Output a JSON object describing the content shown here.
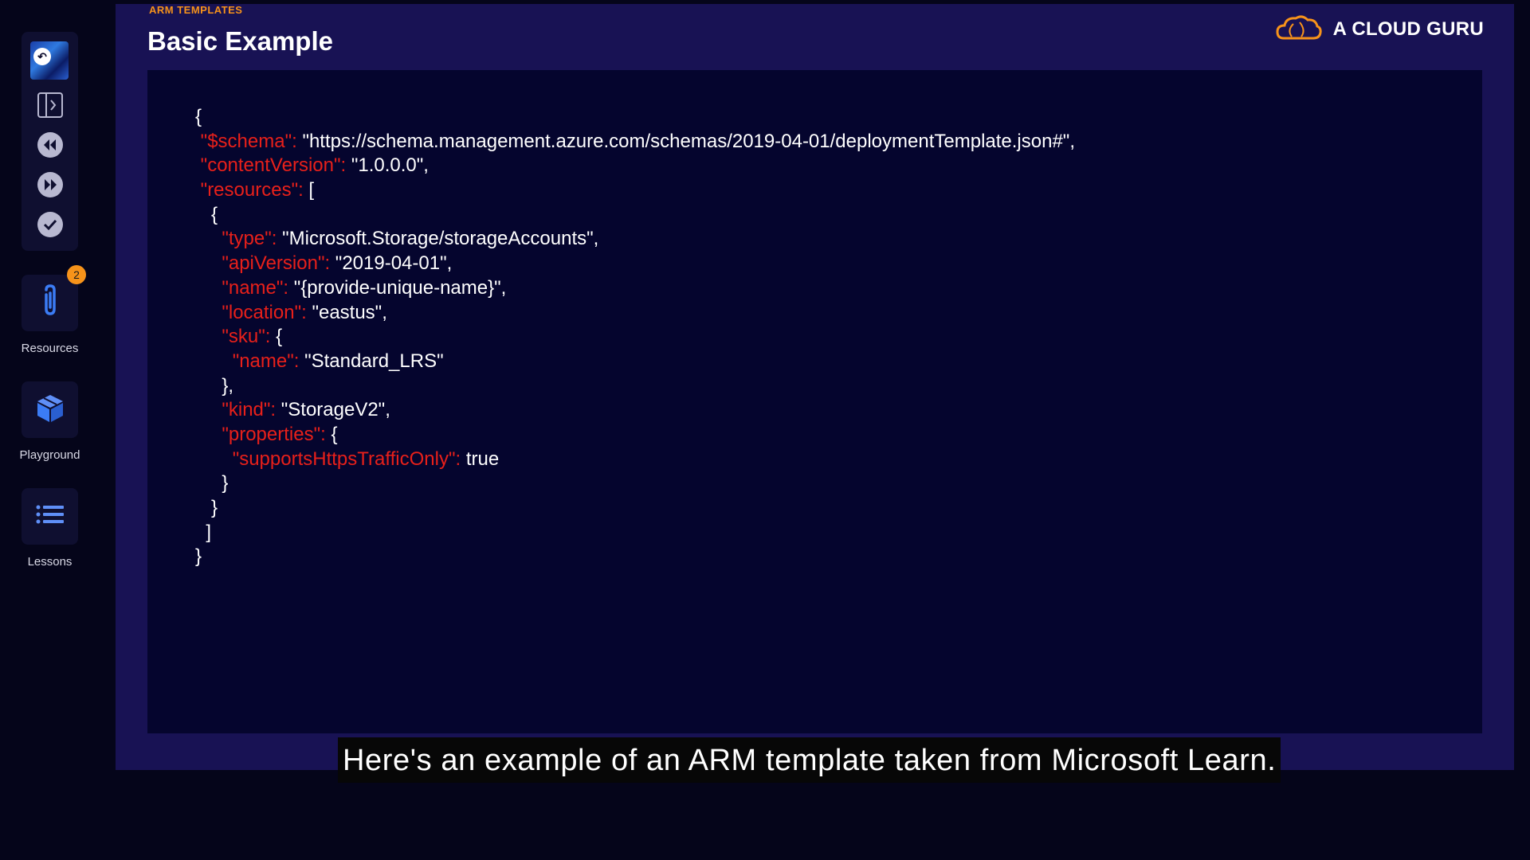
{
  "sidebar": {
    "controls": [
      {
        "icon": "back-arrow-icon"
      },
      {
        "icon": "sidebar-toggle-icon"
      },
      {
        "icon": "rewind-icon"
      },
      {
        "icon": "fast-forward-icon"
      },
      {
        "icon": "check-circle-icon"
      }
    ],
    "resources": {
      "label": "Resources",
      "badge": "2",
      "icon": "paperclip-icon"
    },
    "playground": {
      "label": "Playground",
      "icon": "cube-icon"
    },
    "lessons": {
      "label": "Lessons",
      "icon": "list-icon"
    }
  },
  "slide": {
    "eyebrow": "ARM TEMPLATES",
    "title": "Basic Example",
    "brand": "A CLOUD GURU",
    "code_lines": [
      {
        "indent": "",
        "key": "",
        "value": "{"
      },
      {
        "indent": " ",
        "key": "\"$schema\": ",
        "value": "\"https://schema.management.azure.com/schemas/2019-04-01/deploymentTemplate.json#\","
      },
      {
        "indent": " ",
        "key": "\"contentVersion\": ",
        "value": "\"1.0.0.0\","
      },
      {
        "indent": " ",
        "key": "\"resources\": ",
        "value": "["
      },
      {
        "indent": "   ",
        "key": "",
        "value": "{"
      },
      {
        "indent": "     ",
        "key": "\"type\": ",
        "value": "\"Microsoft.Storage/storageAccounts\","
      },
      {
        "indent": "     ",
        "key": "\"apiVersion\": ",
        "value": "\"2019-04-01\","
      },
      {
        "indent": "     ",
        "key": "\"name\": ",
        "value": "\"{provide-unique-name}\","
      },
      {
        "indent": "     ",
        "key": "\"location\": ",
        "value": "\"eastus\","
      },
      {
        "indent": "     ",
        "key": "\"sku\": ",
        "value": "{"
      },
      {
        "indent": "       ",
        "key": "\"name\": ",
        "value": "\"Standard_LRS\""
      },
      {
        "indent": "     ",
        "key": "",
        "value": "},"
      },
      {
        "indent": "     ",
        "key": "\"kind\": ",
        "value": "\"StorageV2\","
      },
      {
        "indent": "     ",
        "key": "\"properties\": ",
        "value": "{"
      },
      {
        "indent": "       ",
        "key": "\"supportsHttpsTrafficOnly\": ",
        "value": "true"
      },
      {
        "indent": "     ",
        "key": "",
        "value": "}"
      },
      {
        "indent": "   ",
        "key": "",
        "value": "}"
      },
      {
        "indent": "  ",
        "key": "",
        "value": "]"
      },
      {
        "indent": "",
        "key": "",
        "value": "}"
      }
    ]
  },
  "caption": "Here's an example of an ARM template taken from Microsoft Learn.",
  "colors": {
    "accent": "#f7931a",
    "json_key": "#e8201a",
    "slide_bg": "#181254",
    "code_bg": "#05052e"
  }
}
